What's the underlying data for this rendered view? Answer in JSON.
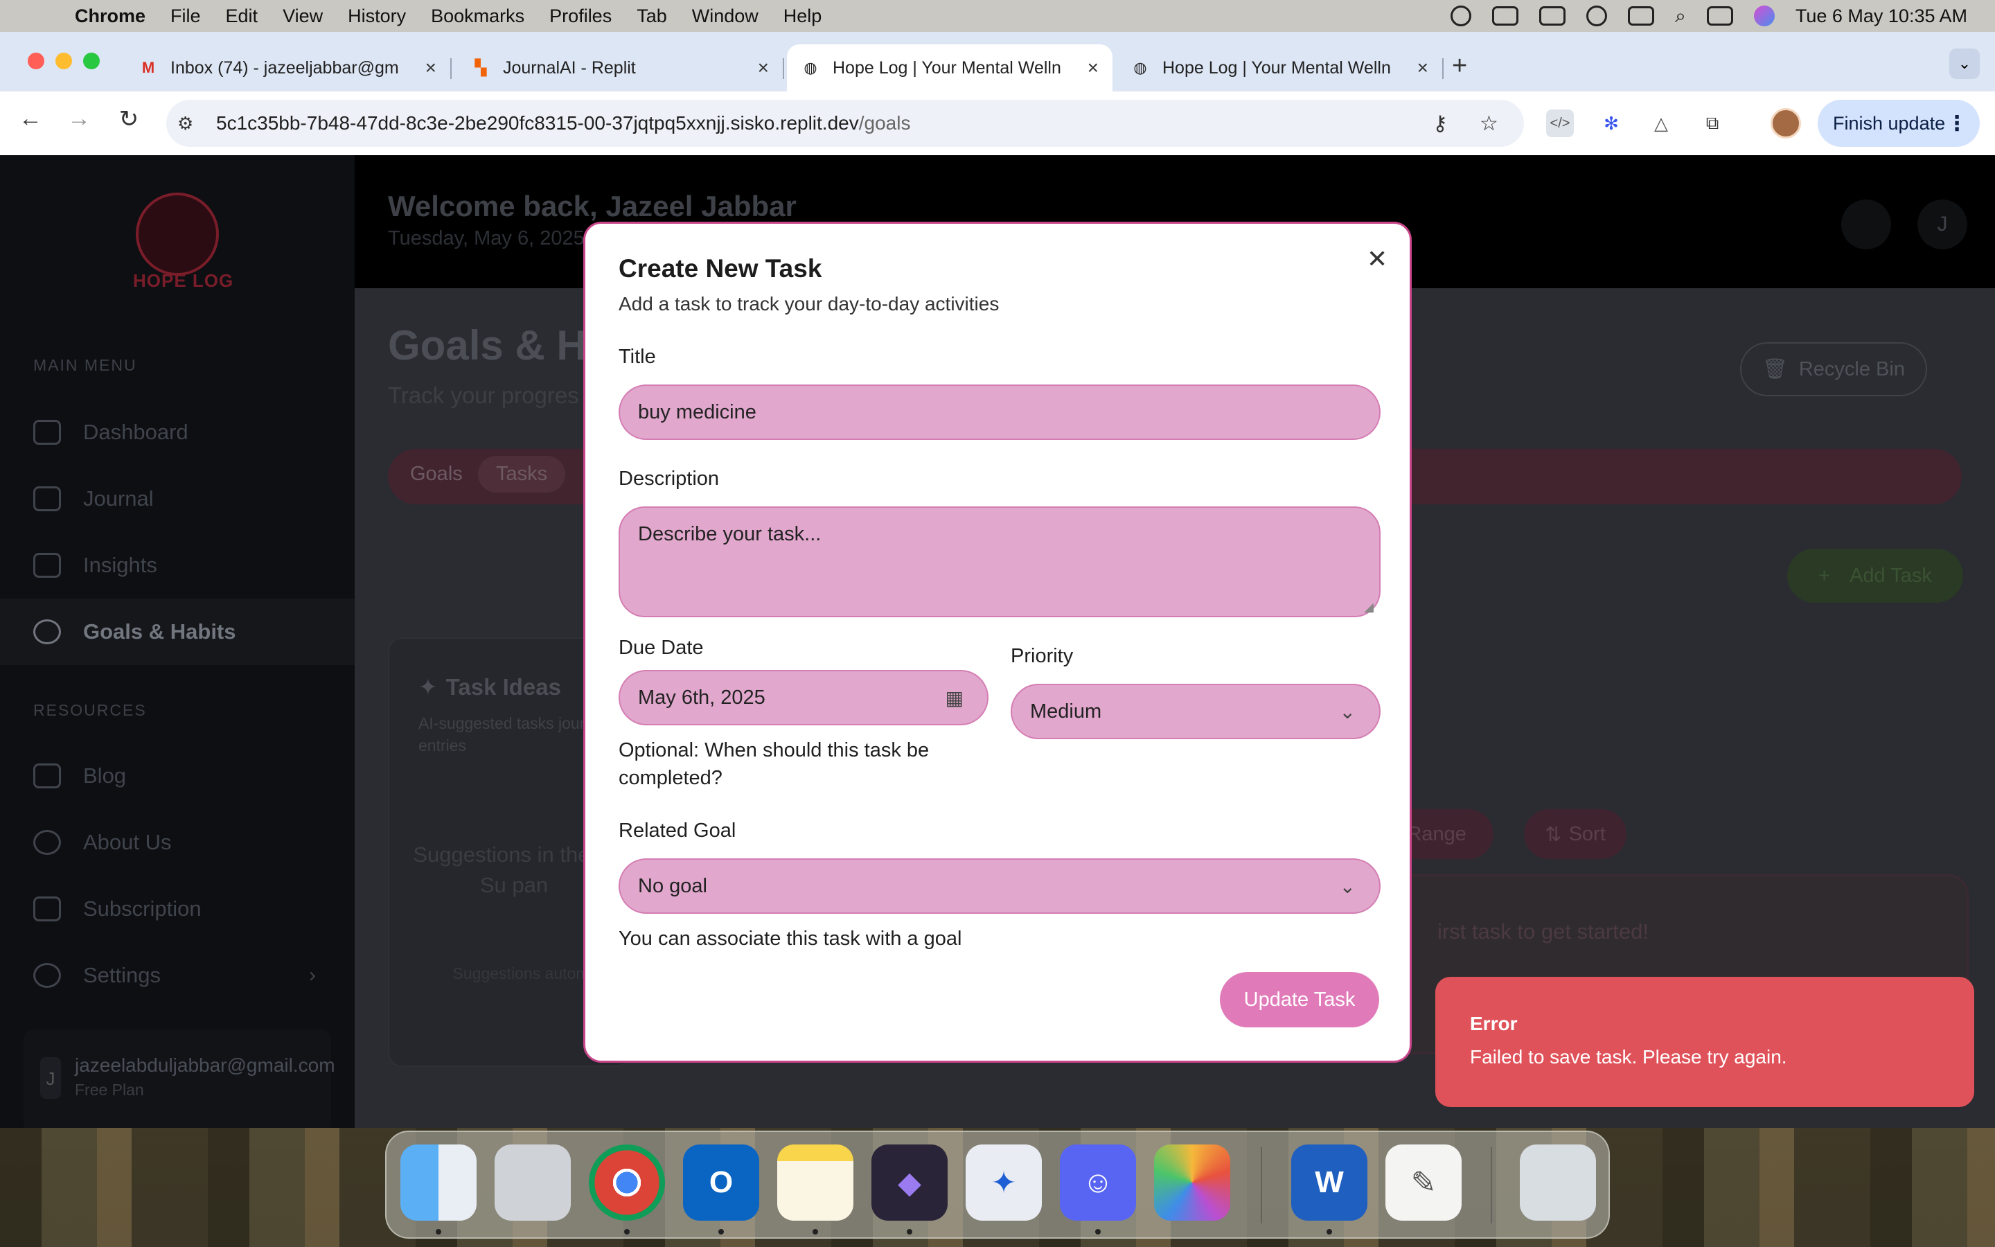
{
  "menubar": {
    "app_name": "Chrome",
    "menus": [
      "File",
      "Edit",
      "View",
      "History",
      "Bookmarks",
      "Profiles",
      "Tab",
      "Window",
      "Help"
    ],
    "clock": "Tue 6 May  10:35 AM"
  },
  "browser": {
    "tabs": [
      {
        "title": "Inbox (74) - jazeeljabbar@gm",
        "icon": "gmail-icon"
      },
      {
        "title": "JournalAI - Replit",
        "icon": "replit-icon"
      },
      {
        "title": "Hope Log | Your Mental Welln",
        "icon": "globe-icon",
        "active": true
      },
      {
        "title": "Hope Log | Your Mental Welln",
        "icon": "globe-icon"
      }
    ],
    "new_tab": "+",
    "url_host": "5c1c35bb-7b48-47dd-8c3e-2be290fc8315-00-37jqtpq5xxnjj.sisko.replit.dev",
    "url_path": "/goals",
    "finish_update": "Finish update"
  },
  "sidebar": {
    "logo_text": "HOPE LOG",
    "main_menu_heading": "MAIN MENU",
    "main_items": [
      "Dashboard",
      "Journal",
      "Insights",
      "Goals & Habits"
    ],
    "resources_heading": "RESOURCES",
    "resource_items": [
      "Blog",
      "About Us",
      "Subscription",
      "Settings"
    ],
    "user_initial": "J",
    "user_email": "jazeelabduljabbar@gmail.com",
    "user_plan": "Free Plan"
  },
  "header": {
    "welcome": "Welcome back, Jazeel Jabbar",
    "date": "Tuesday, May 6, 2025",
    "avatar_initial": "J"
  },
  "page": {
    "title": "Goals & H",
    "subtitle": "Track your progres",
    "recycle_bin": "Recycle Bin",
    "tabs": [
      "Goals",
      "Tasks"
    ],
    "add_task": "Add Task",
    "task_ideas_title": "Task Ideas",
    "task_ideas_desc": "AI-suggested tasks journal entries",
    "suggestions_text": "Suggestions in the AI Su pan",
    "suggestions_note": "Suggestions autom",
    "date_range": "te Range",
    "sort": "Sort",
    "empty_text": "irst task to get started!"
  },
  "modal": {
    "title": "Create New Task",
    "subtitle": "Add a task to track your day-to-day activities",
    "title_label": "Title",
    "title_value": "buy medicine",
    "description_label": "Description",
    "description_placeholder": "Describe your task...",
    "due_date_label": "Due Date",
    "due_date_value": "May 6th, 2025",
    "due_date_hint": "Optional: When should this task be completed?",
    "priority_label": "Priority",
    "priority_value": "Medium",
    "related_goal_label": "Related Goal",
    "related_goal_value": "No goal",
    "related_goal_hint": "You can associate this task with a goal",
    "submit_label": "Update Task"
  },
  "toast": {
    "title": "Error",
    "message": "Failed to save task. Please try again."
  },
  "dock": [
    "Finder",
    "Launchpad",
    "Chrome",
    "Outlook",
    "Notes",
    "Obsidian",
    "Spark",
    "Discord",
    "Photos",
    "Word",
    "TextEdit",
    "Trash"
  ],
  "colors": {
    "modal_accent": "#c8458a",
    "field_bg": "#e2a7cd",
    "submit_button": "#e17ab9",
    "toast_bg": "#e0525a",
    "chrome_active_tab": "#ffffff",
    "finish_update_bg": "#d3e3fd"
  }
}
